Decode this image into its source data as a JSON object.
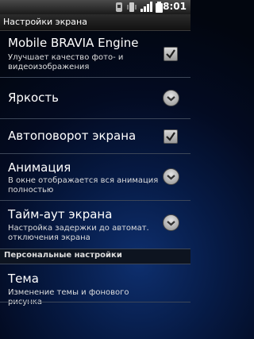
{
  "status": {
    "time": "8:01"
  },
  "window": {
    "title": "Настройки экрана"
  },
  "settings": [
    {
      "title": "Mobile BRAVIA Engine",
      "summary": "Улучшает качество фото- и видеоизображения",
      "control": "checkbox",
      "checked": true
    },
    {
      "title": "Яркость",
      "summary": "",
      "control": "expand"
    },
    {
      "title": "Автоповорот экрана",
      "summary": "",
      "control": "checkbox",
      "checked": true
    },
    {
      "title": "Анимация",
      "summary": "В окне отображается вся анимация полностью",
      "control": "expand"
    },
    {
      "title": "Тайм-аут экрана",
      "summary": "Настройка задержки до автомат. отключения экрана",
      "control": "expand"
    }
  ],
  "section": {
    "label": "Персональные настройки"
  },
  "theme": {
    "title": "Тема",
    "summary": "Изменение темы и фонового рисунка"
  }
}
